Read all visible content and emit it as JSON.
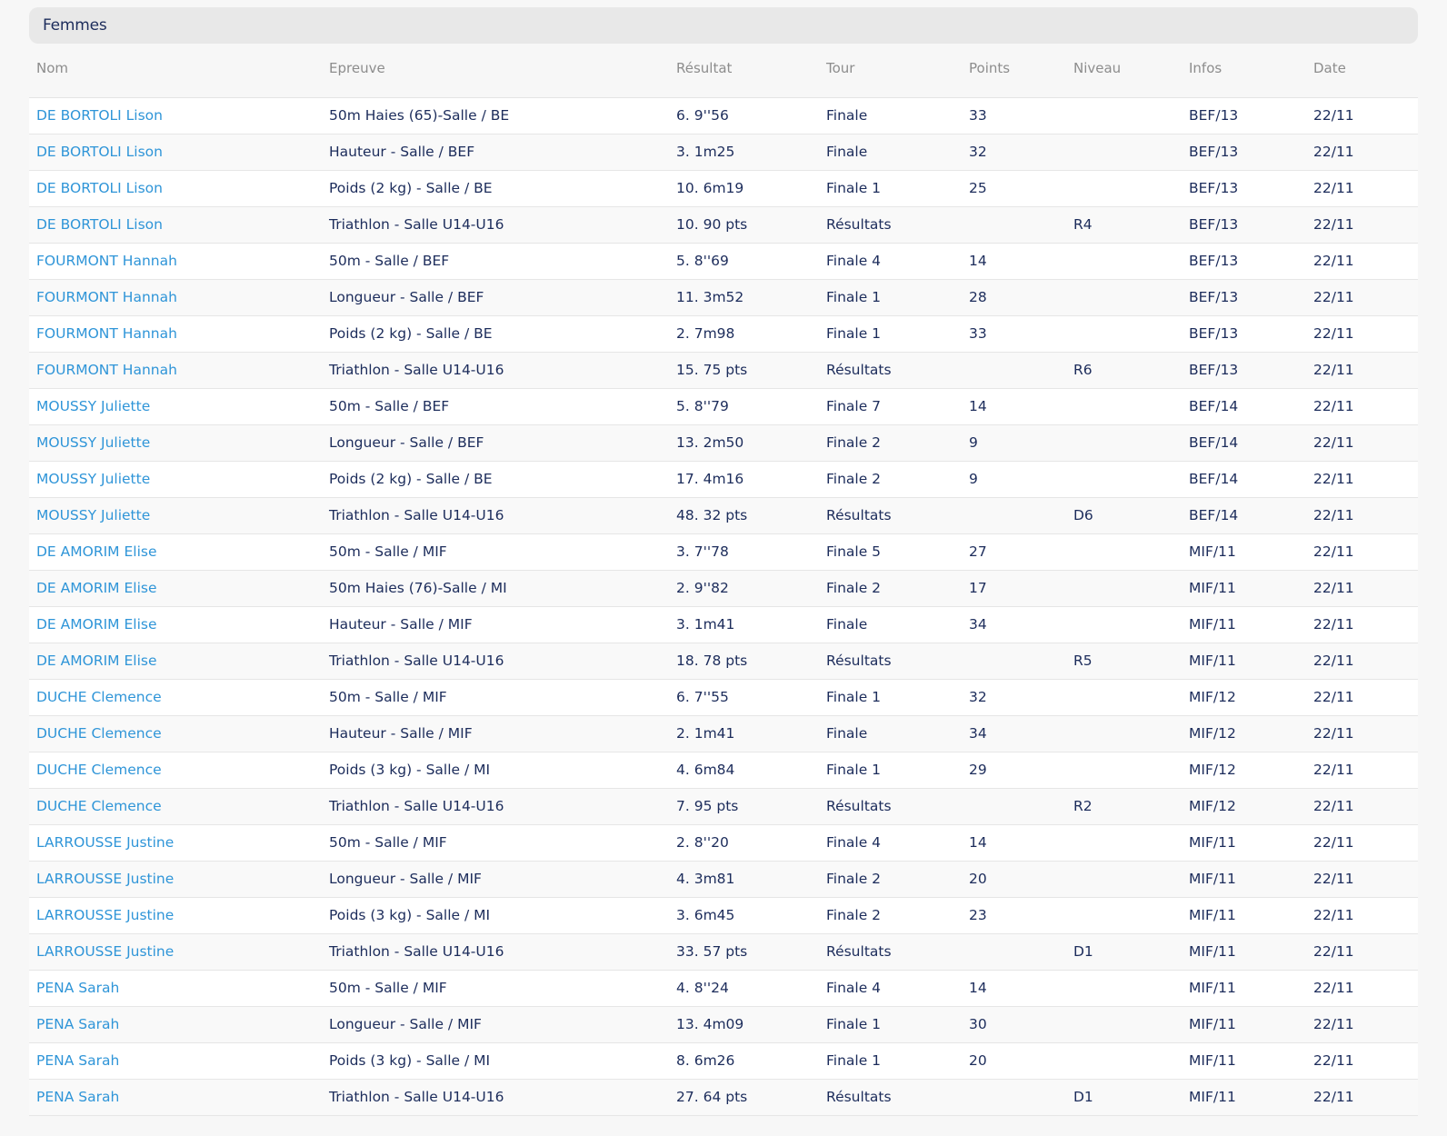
{
  "section": {
    "title": "Femmes"
  },
  "columns": [
    "Nom",
    "Epreuve",
    "Résultat",
    "Tour",
    "Points",
    "Niveau",
    "Infos",
    "Date"
  ],
  "rows": [
    [
      "DE BORTOLI Lison",
      "50m Haies (65)-Salle / BE",
      "6. 9''56",
      "Finale",
      "33",
      "",
      "BEF/13",
      "22/11"
    ],
    [
      "DE BORTOLI Lison",
      "Hauteur - Salle / BEF",
      "3. 1m25",
      "Finale",
      "32",
      "",
      "BEF/13",
      "22/11"
    ],
    [
      "DE BORTOLI Lison",
      "Poids (2 kg) - Salle / BE",
      "10. 6m19",
      "Finale 1",
      "25",
      "",
      "BEF/13",
      "22/11"
    ],
    [
      "DE BORTOLI Lison",
      "Triathlon - Salle U14-U16",
      "10. 90 pts",
      "Résultats",
      "",
      "R4",
      "BEF/13",
      "22/11"
    ],
    [
      "FOURMONT Hannah",
      "50m - Salle / BEF",
      "5. 8''69",
      "Finale 4",
      "14",
      "",
      "BEF/13",
      "22/11"
    ],
    [
      "FOURMONT Hannah",
      "Longueur - Salle / BEF",
      "11. 3m52",
      "Finale 1",
      "28",
      "",
      "BEF/13",
      "22/11"
    ],
    [
      "FOURMONT Hannah",
      "Poids (2 kg) - Salle / BE",
      "2. 7m98",
      "Finale 1",
      "33",
      "",
      "BEF/13",
      "22/11"
    ],
    [
      "FOURMONT Hannah",
      "Triathlon - Salle U14-U16",
      "15. 75 pts",
      "Résultats",
      "",
      "R6",
      "BEF/13",
      "22/11"
    ],
    [
      "MOUSSY Juliette",
      "50m - Salle / BEF",
      "5. 8''79",
      "Finale 7",
      "14",
      "",
      "BEF/14",
      "22/11"
    ],
    [
      "MOUSSY Juliette",
      "Longueur - Salle / BEF",
      "13. 2m50",
      "Finale 2",
      "9",
      "",
      "BEF/14",
      "22/11"
    ],
    [
      "MOUSSY Juliette",
      "Poids (2 kg) - Salle / BE",
      "17. 4m16",
      "Finale 2",
      "9",
      "",
      "BEF/14",
      "22/11"
    ],
    [
      "MOUSSY Juliette",
      "Triathlon - Salle U14-U16",
      "48. 32 pts",
      "Résultats",
      "",
      "D6",
      "BEF/14",
      "22/11"
    ],
    [
      "DE AMORIM Elise",
      "50m - Salle / MIF",
      "3. 7''78",
      "Finale 5",
      "27",
      "",
      "MIF/11",
      "22/11"
    ],
    [
      "DE AMORIM Elise",
      "50m Haies (76)-Salle / MI",
      "2. 9''82",
      "Finale 2",
      "17",
      "",
      "MIF/11",
      "22/11"
    ],
    [
      "DE AMORIM Elise",
      "Hauteur - Salle / MIF",
      "3. 1m41",
      "Finale",
      "34",
      "",
      "MIF/11",
      "22/11"
    ],
    [
      "DE AMORIM Elise",
      "Triathlon - Salle U14-U16",
      "18. 78 pts",
      "Résultats",
      "",
      "R5",
      "MIF/11",
      "22/11"
    ],
    [
      "DUCHE Clemence",
      "50m - Salle / MIF",
      "6. 7''55",
      "Finale 1",
      "32",
      "",
      "MIF/12",
      "22/11"
    ],
    [
      "DUCHE Clemence",
      "Hauteur - Salle / MIF",
      "2. 1m41",
      "Finale",
      "34",
      "",
      "MIF/12",
      "22/11"
    ],
    [
      "DUCHE Clemence",
      "Poids (3 kg) - Salle / MI",
      "4. 6m84",
      "Finale 1",
      "29",
      "",
      "MIF/12",
      "22/11"
    ],
    [
      "DUCHE Clemence",
      "Triathlon - Salle U14-U16",
      "7. 95 pts",
      "Résultats",
      "",
      "R2",
      "MIF/12",
      "22/11"
    ],
    [
      "LARROUSSE Justine",
      "50m - Salle / MIF",
      "2. 8''20",
      "Finale 4",
      "14",
      "",
      "MIF/11",
      "22/11"
    ],
    [
      "LARROUSSE Justine",
      "Longueur - Salle / MIF",
      "4. 3m81",
      "Finale 2",
      "20",
      "",
      "MIF/11",
      "22/11"
    ],
    [
      "LARROUSSE Justine",
      "Poids (3 kg) - Salle / MI",
      "3. 6m45",
      "Finale 2",
      "23",
      "",
      "MIF/11",
      "22/11"
    ],
    [
      "LARROUSSE Justine",
      "Triathlon - Salle U14-U16",
      "33. 57 pts",
      "Résultats",
      "",
      "D1",
      "MIF/11",
      "22/11"
    ],
    [
      "PENA Sarah",
      "50m - Salle / MIF",
      "4. 8''24",
      "Finale 4",
      "14",
      "",
      "MIF/11",
      "22/11"
    ],
    [
      "PENA Sarah",
      "Longueur - Salle / MIF",
      "13. 4m09",
      "Finale 1",
      "30",
      "",
      "MIF/11",
      "22/11"
    ],
    [
      "PENA Sarah",
      "Poids (3 kg) - Salle / MI",
      "8. 6m26",
      "Finale 1",
      "20",
      "",
      "MIF/11",
      "22/11"
    ],
    [
      "PENA Sarah",
      "Triathlon - Salle U14-U16",
      "27. 64 pts",
      "Résultats",
      "",
      "D1",
      "MIF/11",
      "22/11"
    ]
  ]
}
